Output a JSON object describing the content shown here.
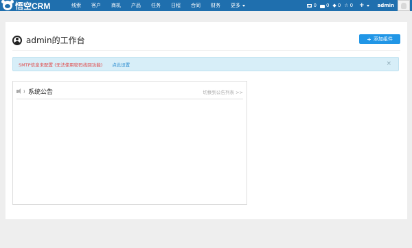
{
  "brand": {
    "name": "悟空CRM",
    "logo_icon": "monkey-logo-icon"
  },
  "nav": {
    "items": [
      {
        "label": "线索"
      },
      {
        "label": "客户"
      },
      {
        "label": "商机"
      },
      {
        "label": "产品"
      },
      {
        "label": "任务"
      },
      {
        "label": "日程"
      },
      {
        "label": "合同"
      },
      {
        "label": "财务"
      },
      {
        "label": "更多"
      }
    ]
  },
  "header_right": {
    "mail_count": "0",
    "folder_count": "0",
    "diamond_count": "0",
    "star_count": "0",
    "plus_label": "+",
    "username": "admin"
  },
  "page": {
    "title": "admin的工作台",
    "add_widget_label": "添加组件"
  },
  "alert": {
    "text": "SMTP信息未配置 (无法使用密码找回功能)",
    "link": "点此设置",
    "close": "×"
  },
  "notice": {
    "title": "系统公告",
    "switch_link": "切换到公告列表 >>"
  },
  "colors": {
    "navbar": "#1f6fae",
    "accent": "#2196e6",
    "alert_bg": "#d7eef8",
    "alert_text": "#e04848",
    "link": "#2a8ccf"
  }
}
